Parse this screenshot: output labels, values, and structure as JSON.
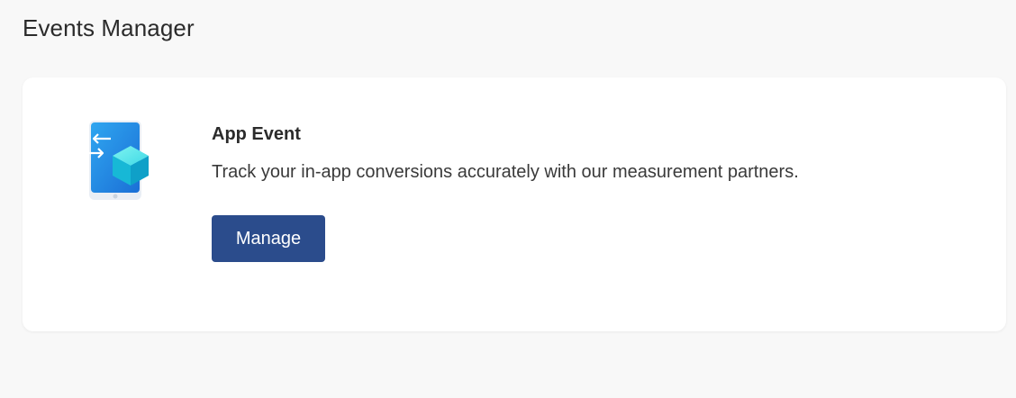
{
  "header": {
    "title": "Events Manager"
  },
  "card": {
    "icon": "phone-cube-sync-icon",
    "title": "App Event",
    "description": "Track your in-app conversions accurately with our measurement partners.",
    "button_label": "Manage"
  },
  "colors": {
    "page_background": "#f8f8f8",
    "card_background": "#ffffff",
    "button_background": "#2b4c8c",
    "button_text": "#ffffff",
    "icon_phone": "#1e90e8",
    "icon_cube": "#19c5d9"
  }
}
